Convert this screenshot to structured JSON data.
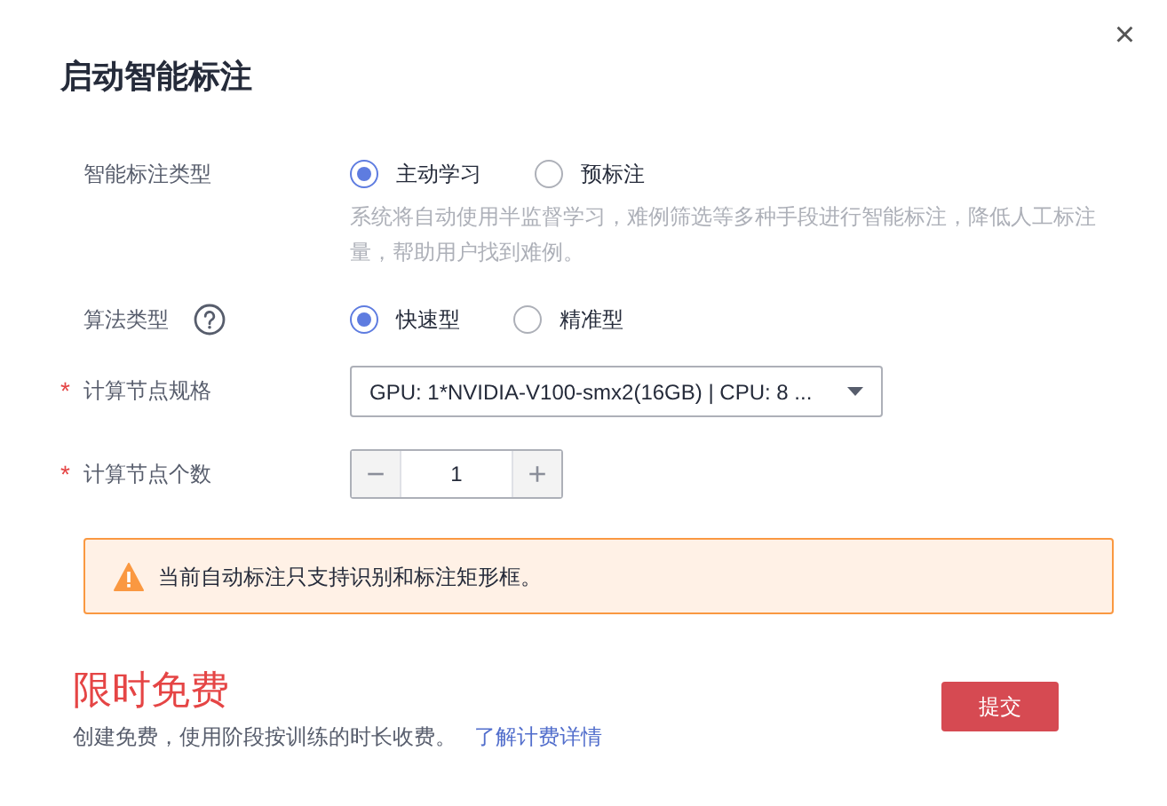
{
  "dialog": {
    "title": "启动智能标注",
    "close": "×"
  },
  "fields": [
    {
      "kind": "radio",
      "label": "智能标注类型",
      "options": [
        {
          "label": "主动学习",
          "selected": true
        },
        {
          "label": "预标注",
          "selected": false
        }
      ],
      "description": "系统将自动使用半监督学习，难例筛选等多种手段进行智能标注，降低人工标注量，帮助用户找到难例。"
    },
    {
      "kind": "radio",
      "label": "算法类型",
      "help": true,
      "options": [
        {
          "label": "快速型",
          "selected": true
        },
        {
          "label": "精准型",
          "selected": false
        }
      ]
    },
    {
      "kind": "select",
      "label": "计算节点规格",
      "required_mark": "*",
      "value": "GPU: 1*NVIDIA-V100-smx2(16GB) | CPU: 8 ..."
    },
    {
      "kind": "stepper",
      "label": "计算节点个数",
      "required_mark": "*",
      "value": "1",
      "minus": "−",
      "plus": "+"
    }
  ],
  "alert": {
    "text": "当前自动标注只支持识别和标注矩形框。"
  },
  "footer": {
    "price": "限时免费",
    "note": "创建免费，使用阶段按训练的时长收费。",
    "link": "了解计费详情",
    "submit": "提交"
  }
}
